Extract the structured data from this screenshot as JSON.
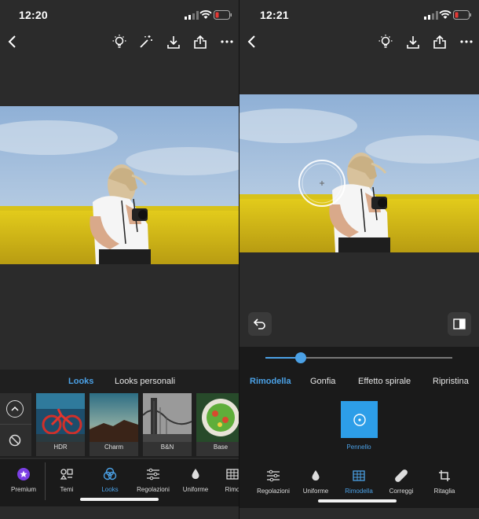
{
  "left": {
    "status": {
      "time": "12:20"
    },
    "looks_tabs": {
      "active": "Looks",
      "other": "Looks personali"
    },
    "presets": [
      {
        "label": "HDR"
      },
      {
        "label": "Charm"
      },
      {
        "label": "B&N"
      },
      {
        "label": "Base"
      }
    ],
    "nav": [
      {
        "label": "Premium",
        "icon": "star-icon"
      },
      {
        "label": "Temi",
        "icon": "themes-icon"
      },
      {
        "label": "Looks",
        "icon": "looks-icon"
      },
      {
        "label": "Regolazioni",
        "icon": "sliders-icon"
      },
      {
        "label": "Uniforme",
        "icon": "drop-icon"
      },
      {
        "label": "Rimo",
        "icon": "grid-icon"
      }
    ]
  },
  "right": {
    "status": {
      "time": "12:21"
    },
    "modes": [
      "Rimodella",
      "Gonfia",
      "Effetto spirale",
      "Ripristina"
    ],
    "brush_label": "Pennello",
    "slider_value": 0.19,
    "nav": [
      {
        "label": "Regolazioni",
        "icon": "sliders-icon"
      },
      {
        "label": "Uniforme",
        "icon": "drop-icon"
      },
      {
        "label": "Rimodella",
        "icon": "grid-icon"
      },
      {
        "label": "Correggi",
        "icon": "bandage-icon"
      },
      {
        "label": "Ritaglia",
        "icon": "crop-icon"
      }
    ]
  },
  "colors": {
    "accent": "#4ba1e6",
    "background": "#2b2b2b",
    "panel": "#1a1a1a"
  }
}
